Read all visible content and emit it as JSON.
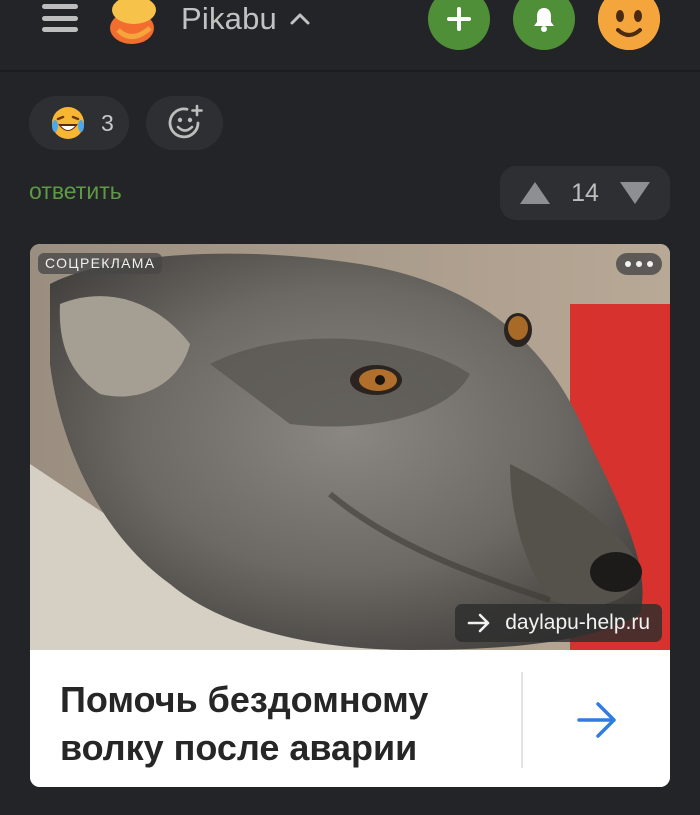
{
  "header": {
    "brand": "Pikabu",
    "menu_icon": "hamburger-icon",
    "add_icon": "plus-icon",
    "notifications_icon": "bell-icon",
    "avatar_icon": "smiley-avatar-icon"
  },
  "reactions": {
    "items": [
      {
        "icon": "laughing-emoji-icon",
        "count": "3"
      }
    ],
    "add_icon": "add-reaction-icon"
  },
  "comment": {
    "reply_label": "ответить",
    "rating": "14"
  },
  "ad": {
    "label": "СОЦРЕКЛАМА",
    "domain": "daylapu-help.ru",
    "title": "Помочь бездомному волку после аварии",
    "image_icon": "wolf-photo"
  },
  "colors": {
    "background": "#232427",
    "accent_green": "#4f8f38",
    "reply_green": "#5e9a45",
    "link_blue": "#2f7de1",
    "avatar_orange": "#f4a63c"
  }
}
